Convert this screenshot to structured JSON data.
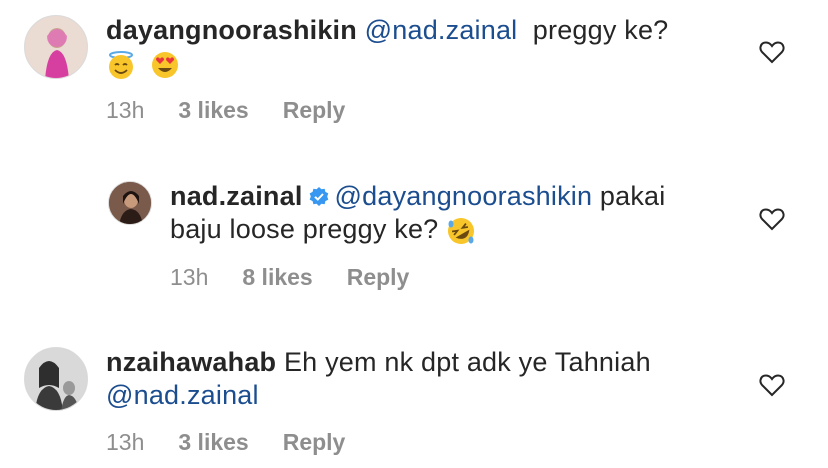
{
  "comments": [
    {
      "username": "dayangnoorashikin",
      "mention": "@nad.zainal",
      "text_after": "preggy ke?",
      "emojis": [
        "smiling-face-with-halo",
        "heart-eyes-face"
      ],
      "time": "13h",
      "likes": "3 likes",
      "reply_label": "Reply"
    },
    {
      "username": "nad.zainal",
      "verified": true,
      "mention": "@dayangnoorashikin",
      "text_line1_after": "pakai",
      "text_line2": "baju loose preggy ke?",
      "emojis": [
        "rolling-on-floor-laughing-face"
      ],
      "time": "13h",
      "likes": "8 likes",
      "reply_label": "Reply"
    },
    {
      "username": "nzaihawahab",
      "text": "Eh yem nk dpt adk ye Tahniah",
      "mention": "@nad.zainal",
      "time": "13h",
      "likes": "3 likes",
      "reply_label": "Reply"
    }
  ],
  "colors": {
    "mention": "#1b4d8f",
    "meta": "#8e8e8e",
    "verified": "#3897f0"
  }
}
